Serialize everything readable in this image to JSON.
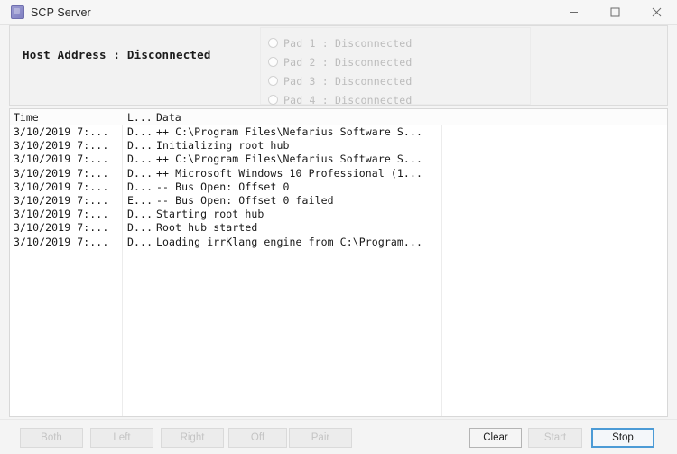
{
  "window": {
    "title": "SCP Server",
    "icon": "app-icon",
    "controls": [
      {
        "name": "minimize",
        "glyph": "minimize-icon"
      },
      {
        "name": "maximize",
        "glyph": "maximize-icon"
      },
      {
        "name": "close",
        "glyph": "close-icon"
      }
    ]
  },
  "status": {
    "host_address": "Host Address : Disconnected",
    "pads": [
      {
        "label": "Pad 1 : Disconnected",
        "connected": false
      },
      {
        "label": "Pad 2 : Disconnected",
        "connected": false
      },
      {
        "label": "Pad 3 : Disconnected",
        "connected": false
      },
      {
        "label": "Pad 4 : Disconnected",
        "connected": false
      }
    ]
  },
  "log": {
    "columns": [
      "Time",
      "L...",
      "Data"
    ],
    "rows": [
      {
        "time": "3/10/2019 7:...",
        "level": "D...",
        "data": "++ C:\\Program Files\\Nefarius Software S..."
      },
      {
        "time": "3/10/2019 7:...",
        "level": "D...",
        "data": "Initializing root hub"
      },
      {
        "time": "3/10/2019 7:...",
        "level": "D...",
        "data": "++ C:\\Program Files\\Nefarius Software S..."
      },
      {
        "time": "3/10/2019 7:...",
        "level": "D...",
        "data": "++ Microsoft Windows 10 Professional (1..."
      },
      {
        "time": "3/10/2019 7:...",
        "level": "D...",
        "data": "-- Bus Open: Offset 0"
      },
      {
        "time": "3/10/2019 7:...",
        "level": "E...",
        "data": "-- Bus Open: Offset 0 failed"
      },
      {
        "time": "3/10/2019 7:...",
        "level": "D...",
        "data": "Starting root hub"
      },
      {
        "time": "3/10/2019 7:...",
        "level": "D...",
        "data": "Root hub started"
      },
      {
        "time": "3/10/2019 7:...",
        "level": "D...",
        "data": "Loading irrKlang engine from C:\\Program..."
      }
    ]
  },
  "buttons": {
    "both": "Both",
    "left": "Left",
    "right": "Right",
    "off": "Off",
    "pair": "Pair",
    "clear": "Clear",
    "start": "Start",
    "stop": "Stop"
  },
  "colors": {
    "focus_border": "#4c9bd6",
    "window_bg": "#f4f4f4",
    "list_bg": "#ffffff",
    "disabled_text": "#c4c4c4",
    "pad_text": "#bcbcbc"
  }
}
